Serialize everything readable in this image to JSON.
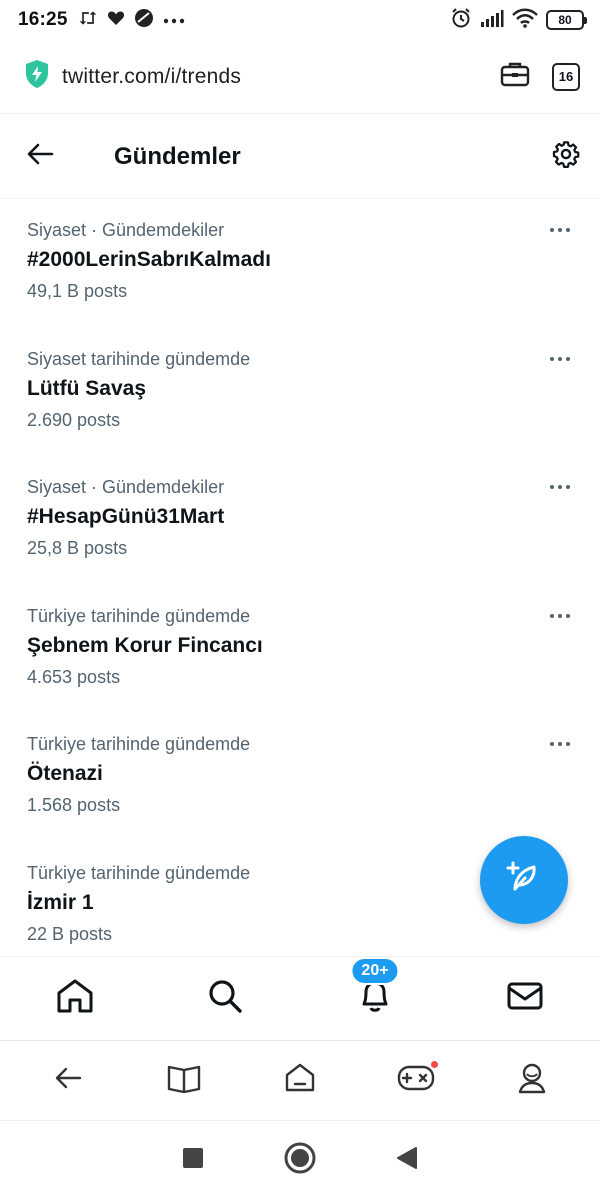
{
  "status_bar": {
    "time": "16:25",
    "battery": "80"
  },
  "browser": {
    "url": "twitter.com/i/trends",
    "tab_count": "16"
  },
  "header": {
    "title": "Gündemler"
  },
  "trends": [
    {
      "context": "Siyaset · Gündemdekiler",
      "name": "#2000LerinSabrıKalmadı",
      "count": "49,1 B posts"
    },
    {
      "context": "Siyaset tarihinde gündemde",
      "name": "Lütfü Savaş",
      "count": "2.690 posts"
    },
    {
      "context": "Siyaset · Gündemdekiler",
      "name": "#HesapGünü31Mart",
      "count": "25,8 B posts"
    },
    {
      "context": "Türkiye tarihinde gündemde",
      "name": "Şebnem Korur Fincancı",
      "count": "4.653 posts"
    },
    {
      "context": "Türkiye tarihinde gündemde",
      "name": "Ötenazi",
      "count": "1.568 posts"
    },
    {
      "context": "Türkiye tarihinde gündemde",
      "name": "İzmir 1",
      "count": "22 B posts"
    }
  ],
  "bottom_nav": {
    "notifications_badge": "20+"
  },
  "colors": {
    "accent": "#1d9bf0",
    "secondary_text": "#536471",
    "primary_text": "#0f1419",
    "dot": "#f24949",
    "secure_shield": "#2ec4a0"
  }
}
